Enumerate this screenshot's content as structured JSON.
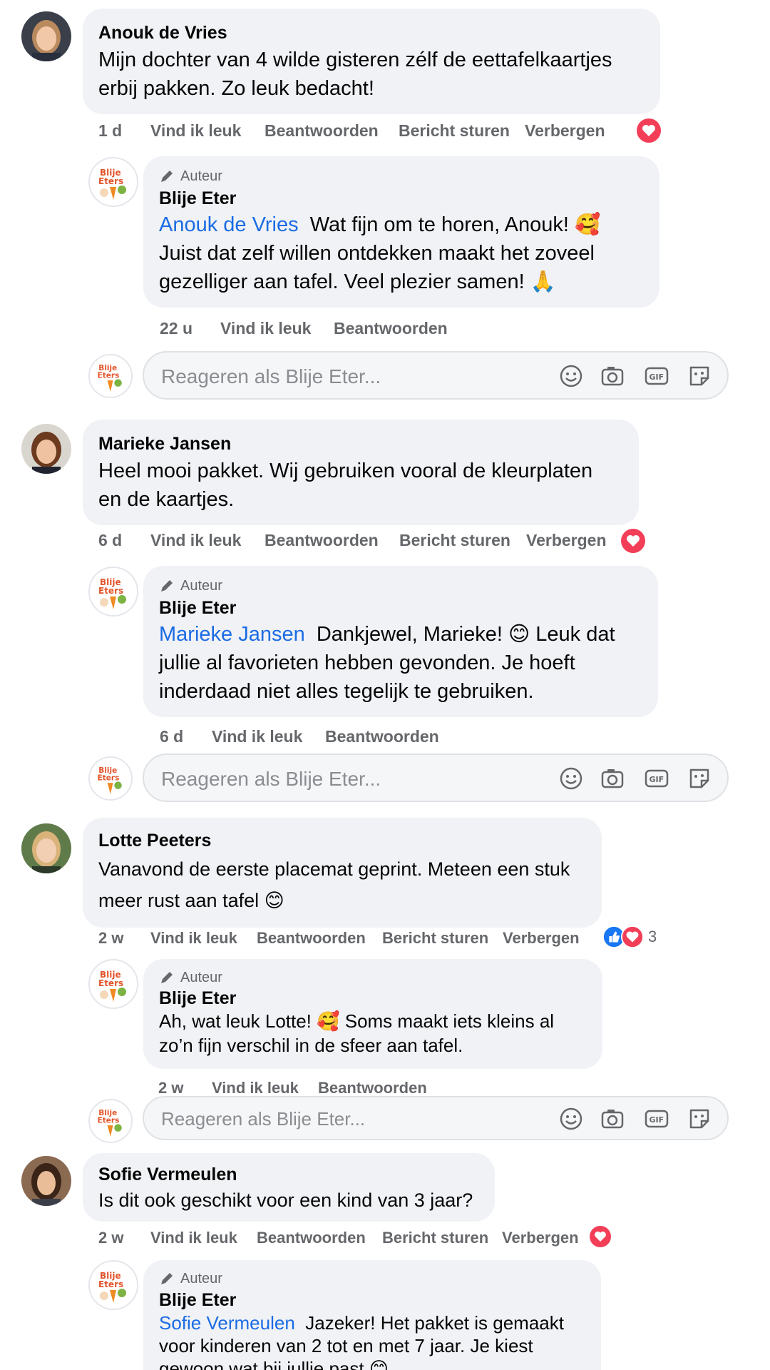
{
  "comments": [
    {
      "author": "Anouk de Vries",
      "text_lines": [
        "Mijn dochter van 4 wilde gisteren zélf de eettafelkaartjes",
        "erbij pakken. Zo leuk bedacht!"
      ],
      "time": "1 d",
      "like": "Vind ik leuk",
      "reply": "Beantwoorden",
      "message": "Bericht sturen",
      "hide": "Verbergen",
      "reaction": "heart",
      "reply_item": {
        "badge": "Auteur",
        "name": "Blije Eter",
        "mention": "Anouk de Vries",
        "text_lines": [
          "Wat fijn om te horen, Anouk! 🥰",
          "Juist dat zelf willen ontdekken maakt het zoveel",
          "gezelliger aan tafel. Veel plezier samen! 🙏"
        ],
        "time": "22 u",
        "like": "Vind ik leuk",
        "reply": "Beantwoorden"
      }
    },
    {
      "author": "Marieke Jansen",
      "text_lines": [
        "Heel mooi pakket. Wij gebruiken vooral de kleurplaten",
        "en de kaartjes."
      ],
      "time": "6 d",
      "like": "Vind ik leuk",
      "reply": "Beantwoorden",
      "message": "Bericht sturen",
      "hide": "Verbergen",
      "reaction": "heart",
      "reply_item": {
        "badge": "Auteur",
        "name": "Blije Eter",
        "mention": "Marieke Jansen",
        "text_lines": [
          "Dankjewel, Marieke! 😊 Leuk dat",
          "jullie al favorieten hebben gevonden. Je hoeft",
          "inderdaad niet alles tegelijk te gebruiken."
        ],
        "time": "6 d",
        "like": "Vind ik leuk",
        "reply": "Beantwoorden"
      }
    },
    {
      "author": "Lotte Peeters",
      "text_lines": [
        "Vanavond de eerste placemat geprint. Meteen een stuk",
        "meer rust aan tafel 😊"
      ],
      "time": "2 w",
      "like": "Vind ik leuk",
      "reply": "Beantwoorden",
      "message": "Bericht sturen",
      "hide": "Verbergen",
      "reaction": "like-heart",
      "reaction_count": "3",
      "reply_item": {
        "badge": "Auteur",
        "name": "Blije Eter",
        "mention": "",
        "text_lines": [
          "Ah, wat leuk Lotte! 🥰 Soms maakt iets kleins al",
          "zo’n fijn verschil in de sfeer aan tafel."
        ],
        "time": "2 w",
        "like": "Vind ik leuk",
        "reply": "Beantwoorden"
      }
    },
    {
      "author": "Sofie Vermeulen",
      "text_lines": [
        "Is dit ook geschikt voor een kind van 3 jaar?"
      ],
      "time": "2 w",
      "like": "Vind ik leuk",
      "reply": "Beantwoorden",
      "message": "Bericht sturen",
      "hide": "Verbergen",
      "reaction": "heart",
      "reply_item": {
        "badge": "Auteur",
        "name": "Blije Eter",
        "mention": "Sofie Vermeulen",
        "text_lines": [
          "Jazeker! Het pakket is gemaakt",
          "voor kinderen van 2 tot en met 7 jaar. Je kiest",
          "gewoon wat bij jullie past 😊"
        ],
        "time": "",
        "like": "",
        "reply": ""
      }
    }
  ],
  "composer": {
    "placeholder": "Reageren als Blije Eter...",
    "icons": [
      "smiley-icon",
      "camera-icon",
      "gif-icon",
      "sticker-icon"
    ]
  },
  "page_logo_text": [
    "Blije",
    "Eters"
  ],
  "colors": {
    "bubble": "#f0f2f5",
    "mention": "#1b6ce4",
    "meta": "#65676b",
    "heart": "#f33e58",
    "like": "#1877f2"
  }
}
